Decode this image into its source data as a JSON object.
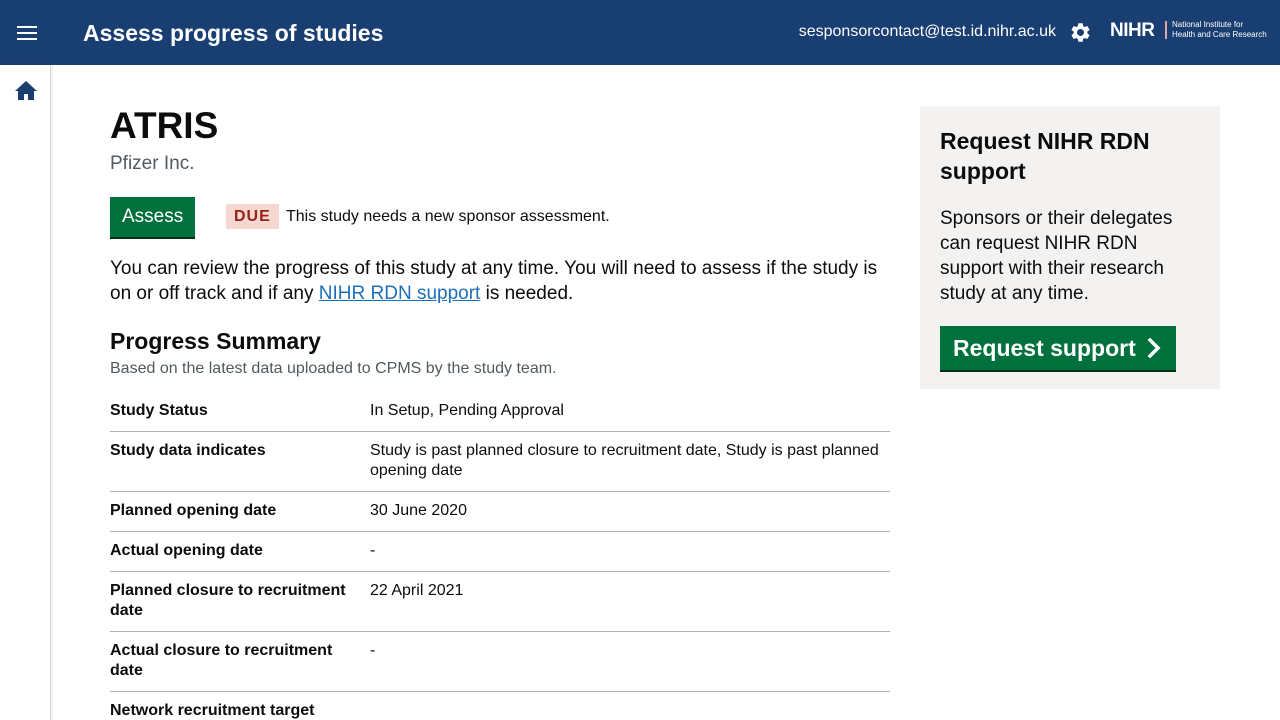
{
  "header": {
    "title": "Assess progress of studies",
    "user_email": "sesponsorcontact@test.id.nihr.ac.uk",
    "logo": {
      "mark": "NIHR",
      "line1": "National Institute for",
      "line2": "Health and Care Research"
    },
    "icons": {
      "menu": "menu-icon",
      "settings": "gear-icon",
      "home": "home-icon"
    },
    "background_color": "#193e72"
  },
  "study": {
    "title": "ATRIS",
    "organisation": "Pfizer Inc.",
    "assess_label": "Assess",
    "status_tag": "DUE",
    "status_message": "This study needs a new sponsor assessment.",
    "intro_before_link": "You can review the progress of this study at any time. You will need to assess if the study is on or off track and if any ",
    "intro_link": "NIHR RDN support",
    "intro_after_link": " is needed."
  },
  "progress": {
    "heading": "Progress Summary",
    "caption": "Based on the latest data uploaded to CPMS by the study team.",
    "rows": [
      {
        "label": "Study Status",
        "value": "In Setup, Pending Approval"
      },
      {
        "label": "Study data indicates",
        "value": "Study is past planned closure to recruitment date, Study is past planned opening date"
      },
      {
        "label": "Planned opening date",
        "value": "30 June 2020"
      },
      {
        "label": "Actual opening date",
        "value": "-"
      },
      {
        "label": "Planned closure to recruitment date",
        "value": "22 April 2021"
      },
      {
        "label": "Actual closure to recruitment date",
        "value": "-"
      },
      {
        "label": "Network recruitment target",
        "value": ""
      }
    ]
  },
  "support_panel": {
    "title": "Request NIHR RDN support",
    "body": "Sponsors or their delegates can request NIHR RDN support with their research study at any time.",
    "button_label": "Request support"
  },
  "colors": {
    "primary_button": "#00703c",
    "link": "#1d70b8",
    "due_tag_bg": "#f6d7d2",
    "due_tag_text": "#942514",
    "panel_bg": "#f3f2f1"
  }
}
